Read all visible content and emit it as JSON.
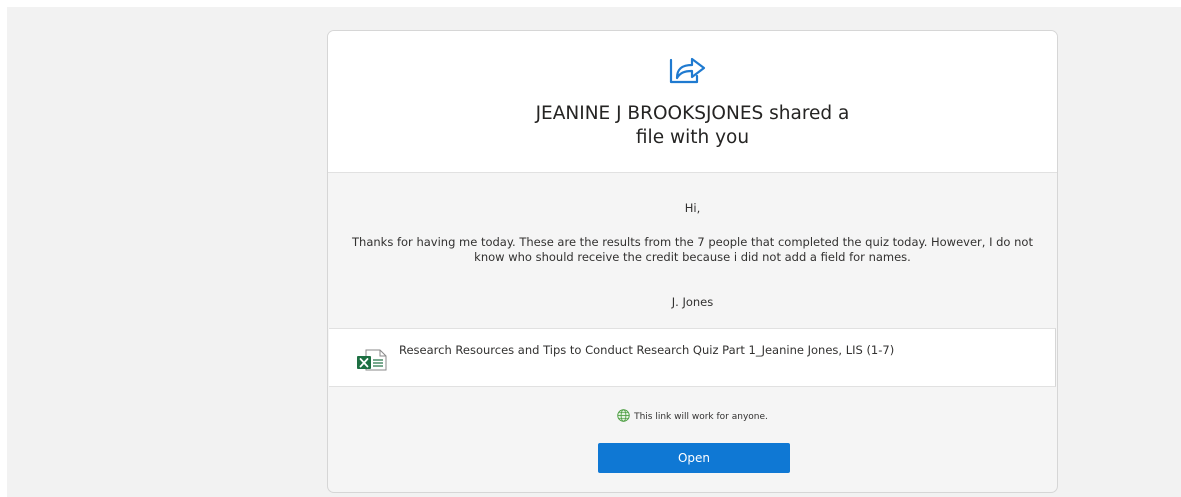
{
  "header": {
    "icon": "share-arrow-icon",
    "title_line1": "JEANINE J BROOKSJONES shared a",
    "title_line2": "file with you"
  },
  "message": {
    "greeting": "Hi,",
    "body": "Thanks for having me today. These are the results from the 7 people that completed the quiz today. However, I do not know who should receive the credit because i did not add a field for names.",
    "signature": "J. Jones"
  },
  "attachment": {
    "icon": "excel-file-icon",
    "name": "Research Resources and Tips to Conduct Research Quiz Part 1_Jeanine Jones, LIS (1-7)"
  },
  "access": {
    "icon": "globe-icon",
    "note": "This link will work for anyone."
  },
  "actions": {
    "open_label": "Open"
  },
  "colors": {
    "accent": "#0f78d4",
    "excel_green": "#1d6f42",
    "globe_green": "#4a9c3f",
    "card_background": "#f5f5f5",
    "header_background": "#ffffff"
  }
}
